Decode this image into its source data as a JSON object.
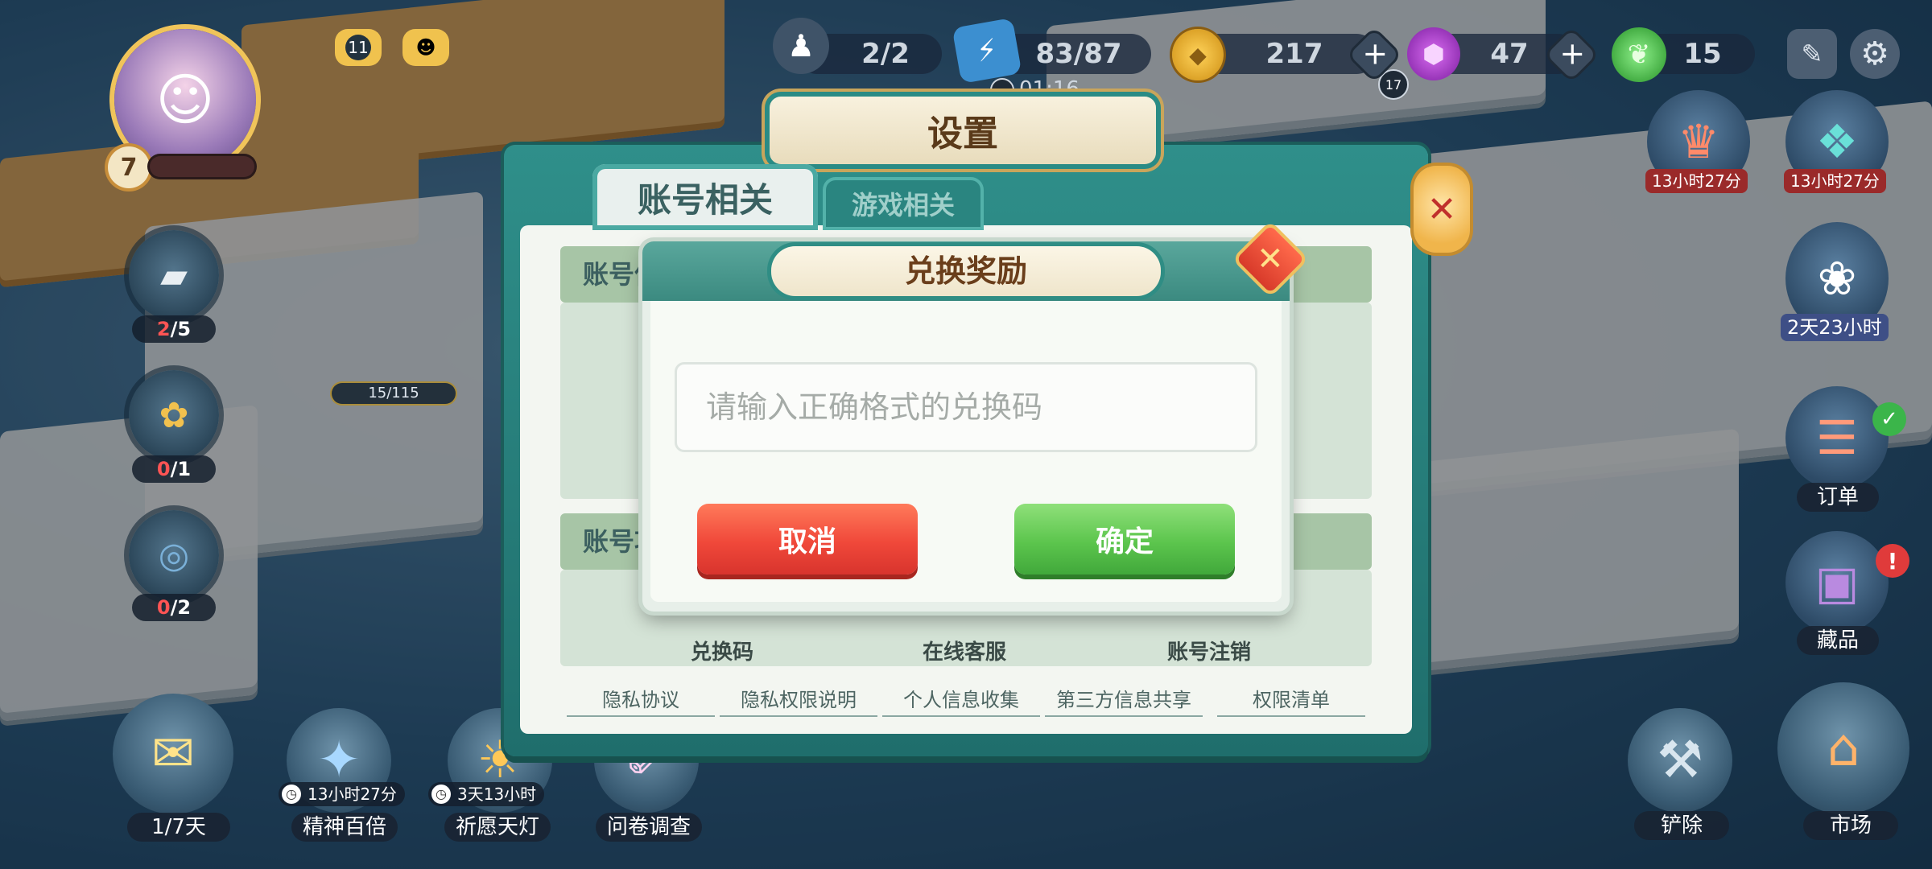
{
  "hud": {
    "level": "7",
    "top_badges": [
      "11"
    ],
    "progress": "2/2",
    "energy": "83/87",
    "energy_timer": "01:16",
    "energy_badge": "17",
    "coins": "217",
    "gems": "47",
    "leaves": "15"
  },
  "left_slots": [
    {
      "current": "2",
      "total": "/5",
      "current_red": true
    },
    {
      "current": "0",
      "total": "/1",
      "current_red": true
    },
    {
      "current": "0",
      "total": "/2",
      "current_red": true
    }
  ],
  "field_progress": "15/115",
  "bottom_bar": [
    {
      "label": "1/7天"
    },
    {
      "label": "精神百倍",
      "timer": "13小时27分"
    },
    {
      "label": "祈愿天灯",
      "timer": "3天13小时"
    },
    {
      "label": "问卷调查"
    },
    {
      "label": "铲除"
    },
    {
      "label": "市场"
    }
  ],
  "right_panel": [
    {
      "time": "13小时27分"
    },
    {
      "time": "13小时27分"
    },
    {
      "time": "2天23小时"
    },
    {
      "label": "订单"
    },
    {
      "label": "藏品"
    }
  ],
  "settings": {
    "title": "设置",
    "tabs": [
      "账号相关",
      "游戏相关"
    ],
    "section_1_title": "账号信",
    "section_2_title": "账号功",
    "functions": [
      "兑换码",
      "在线客服",
      "账号注销"
    ],
    "links": [
      "隐私协议",
      "隐私权限说明",
      "个人信息收集",
      "第三方信息共享",
      "权限清单"
    ]
  },
  "redeem": {
    "title": "兑换奖励",
    "placeholder": "请输入正确格式的兑换码",
    "value": "",
    "cancel_label": "取消",
    "confirm_label": "确定"
  },
  "colors": {
    "cancel": "#f0483a",
    "confirm": "#5cc54d",
    "panel_teal": "#2f8f8a",
    "title_brown": "#6a3e1b"
  }
}
